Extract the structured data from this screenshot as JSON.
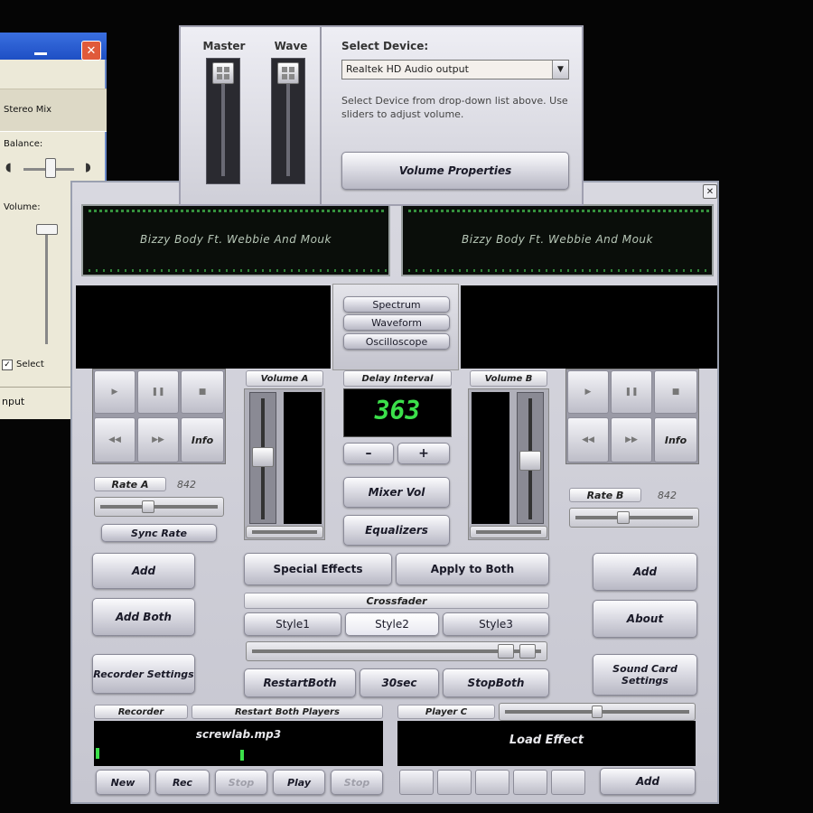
{
  "winmixer": {
    "stereo_mix": "Stereo Mix",
    "balance": "Balance:",
    "volume": "Volume:",
    "select": "Select",
    "close": "✕",
    "footer": "nput"
  },
  "volpanel": {
    "master_label": "Master",
    "wave_label": "Wave",
    "select_device_label": "Select Device:",
    "device_value": "Realtek HD Audio output",
    "instructions": "Select Device from drop-down list above. Use sliders to adjust volume.",
    "volume_properties": "Volume Properties"
  },
  "mainwin": {
    "close": "✕",
    "display_a": {
      "title": "Bizzy Body Ft. Webbie And Mouk"
    },
    "display_b": {
      "title": "Bizzy Body Ft. Webbie And Mouk"
    },
    "viz": {
      "spectrum": "Spectrum",
      "waveform": "Waveform",
      "oscilloscope": "Oscilloscope"
    },
    "left": {
      "info": "Info",
      "rate_label": "Rate A",
      "rate_value": "842",
      "sync_rate": "Sync Rate",
      "add": "Add",
      "add_both": "Add Both",
      "recorder_settings": "Recorder Settings"
    },
    "right": {
      "info": "Info",
      "rate_label": "Rate B",
      "rate_value": "842",
      "add": "Add",
      "about": "About",
      "sound_card_settings": "Sound Card Settings"
    },
    "center": {
      "volume_a": "Volume A",
      "volume_b": "Volume B",
      "delay_interval": "Delay Interval",
      "delay_value": "363",
      "minus": "–",
      "plus": "+",
      "mixer_vol": "Mixer Vol",
      "equalizers": "Equalizers",
      "special_effects": "Special Effects",
      "apply_to_both": "Apply to Both",
      "crossfader": "Crossfader",
      "style1": "Style1",
      "style2": "Style2",
      "style3": "Style3",
      "restart_both": "RestartBoth",
      "thirty_sec": "30sec",
      "stop_both": "StopBoth"
    },
    "recorder": {
      "label": "Recorder",
      "restart_both_players": "Restart Both Players",
      "file": "screwlab.mp3",
      "new": "New",
      "rec": "Rec",
      "stop1": "Stop",
      "play": "Play",
      "stop2": "Stop"
    },
    "player_c": {
      "label": "Player C",
      "load_effect": "Load Effect",
      "add": "Add"
    }
  }
}
